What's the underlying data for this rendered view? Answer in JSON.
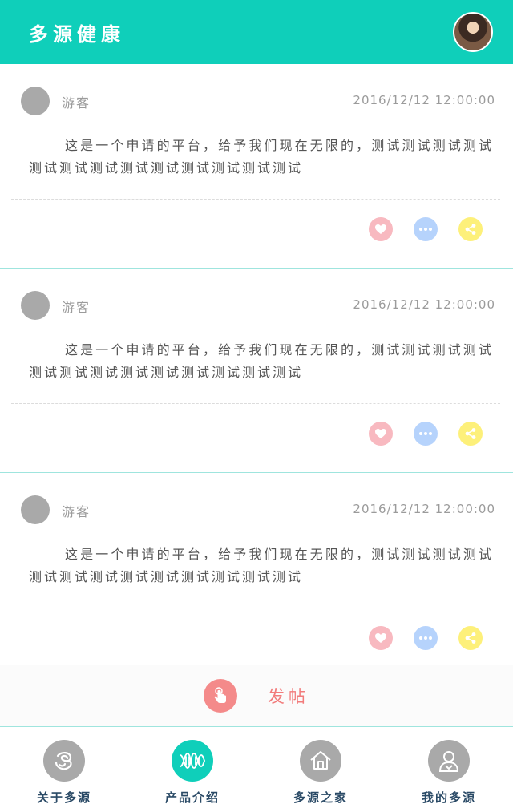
{
  "header": {
    "title": "多源健康"
  },
  "posts": [
    {
      "username": "游客",
      "timestamp": "2016/12/12 12:00:00",
      "content": "这是一个申请的平台，给予我们现在无限的，测试测试测试测试测试测试测试测试测试测试测试测试测试"
    },
    {
      "username": "游客",
      "timestamp": "2016/12/12 12:00:00",
      "content": "这是一个申请的平台，给予我们现在无限的，测试测试测试测试测试测试测试测试测试测试测试测试测试"
    },
    {
      "username": "游客",
      "timestamp": "2016/12/12 12:00:00",
      "content": "这是一个申请的平台，给予我们现在无限的，测试测试测试测试测试测试测试测试测试测试测试测试测试"
    }
  ],
  "post_bar": {
    "label": "发帖",
    "icon": "hand-tap-icon"
  },
  "tabs": [
    {
      "label": "关于多源",
      "icon": "spiral-icon",
      "active": false
    },
    {
      "label": "产品介绍",
      "icon": "dna-icon",
      "active": true
    },
    {
      "label": "多源之家",
      "icon": "home-icon",
      "active": false
    },
    {
      "label": "我的多源",
      "icon": "user-icon",
      "active": false
    }
  ],
  "colors": {
    "accent": "#0fcfba",
    "like": "#f8b9c0",
    "comment": "#b6d3fc",
    "share": "#fdf07a",
    "post_button": "#f48a8a"
  }
}
